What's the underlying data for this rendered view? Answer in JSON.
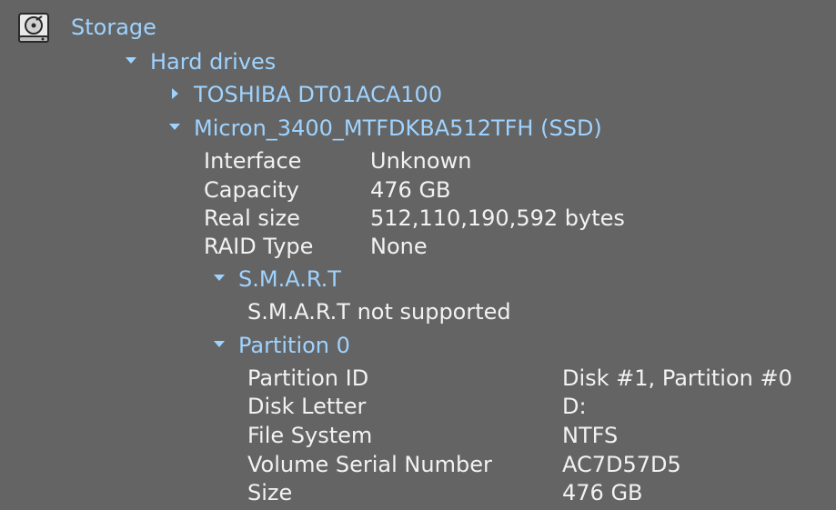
{
  "storage": {
    "title": "Storage",
    "icon": "hard-disk-icon"
  },
  "hard_drives": {
    "label": "Hard drives",
    "drives": [
      {
        "name": "TOSHIBA DT01ACA100",
        "expanded": false
      },
      {
        "name": "Micron_3400_MTFDKBA512TFH (SSD)",
        "expanded": true
      }
    ]
  },
  "micron": {
    "props": [
      {
        "key": "Interface",
        "value": "Unknown"
      },
      {
        "key": "Capacity",
        "value": "476 GB"
      },
      {
        "key": "Real size",
        "value": "512,110,190,592 bytes"
      },
      {
        "key": "RAID Type",
        "value": "None"
      }
    ],
    "smart": {
      "label": "S.M.A.R.T",
      "message": "S.M.A.R.T not supported"
    },
    "partition": {
      "label": "Partition 0",
      "props": [
        {
          "key": "Partition ID",
          "value": "Disk #1, Partition #0"
        },
        {
          "key": "Disk Letter",
          "value": "D:"
        },
        {
          "key": "File System",
          "value": "NTFS"
        },
        {
          "key": "Volume Serial Number",
          "value": "AC7D57D5"
        },
        {
          "key": "Size",
          "value": "476 GB"
        }
      ]
    }
  },
  "colors": {
    "background": "#646464",
    "link": "#9fd3ff",
    "text": "#f2f2f2"
  }
}
